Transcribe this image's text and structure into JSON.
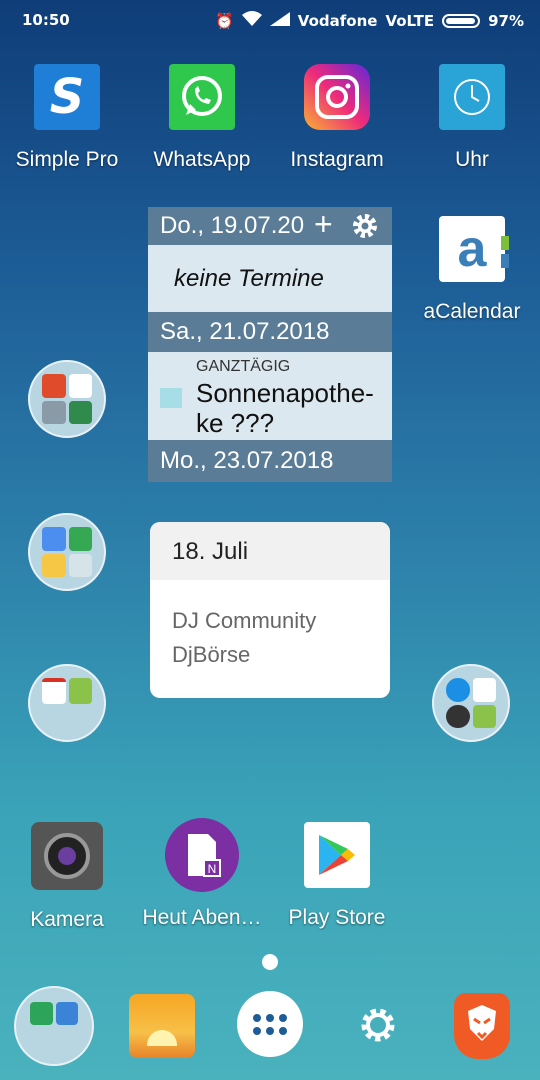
{
  "status_bar": {
    "time": "10:50",
    "carrier": "Vodafone",
    "network": "VoLTE",
    "battery": "97%"
  },
  "apps_row1": [
    {
      "label": "Simple Pro",
      "icon": "simple-pro-icon"
    },
    {
      "label": "WhatsApp",
      "icon": "whatsapp-icon"
    },
    {
      "label": "Instagram",
      "icon": "instagram-icon"
    },
    {
      "label": "Uhr",
      "icon": "clock-icon"
    }
  ],
  "acalendar": {
    "label": "aCalendar",
    "icon": "acalendar-icon"
  },
  "calendar_widget": {
    "day1": "Do., 19.07.20",
    "day1_event": "keine Termine",
    "day2": "Sa., 21.07.2018",
    "day2_event_type": "GANZTÄGIG",
    "day2_event_title": "Sonnenapothe-ke ???",
    "day3": "Mo., 23.07.2018",
    "add_glyph": "+",
    "settings_icon": "gear-icon"
  },
  "note_widget": {
    "date": "18. Juli",
    "line1": "DJ Community",
    "line2": "DjBörse"
  },
  "apps_row_bottom": [
    {
      "label": "Kamera",
      "icon": "camera-icon"
    },
    {
      "label": "Heut Aben…",
      "icon": "onenote-icon"
    },
    {
      "label": "Play Store",
      "icon": "play-store-icon"
    }
  ],
  "dock": [
    {
      "name": "contacts-folder"
    },
    {
      "name": "sunrise-app"
    },
    {
      "name": "app-drawer"
    },
    {
      "name": "settings"
    },
    {
      "name": "brave-browser"
    }
  ]
}
